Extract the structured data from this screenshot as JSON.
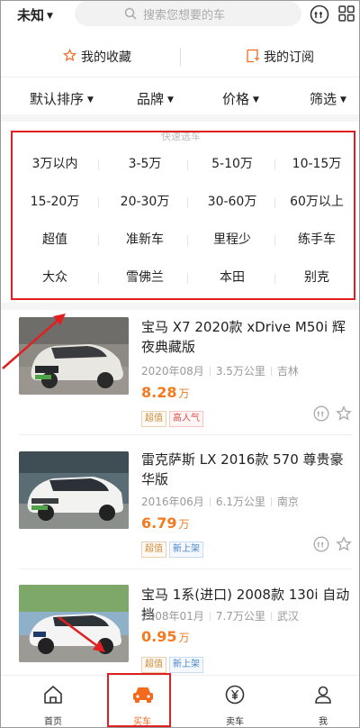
{
  "topbar": {
    "city": "未知",
    "search_placeholder": "搜索您想要的车"
  },
  "favorites": {
    "collect_label": "我的收藏",
    "subscribe_label": "我的订阅"
  },
  "filters": [
    "默认排序",
    "品牌",
    "价格",
    "筛选"
  ],
  "quick_select": {
    "title": "快速选车",
    "rows": [
      [
        "3万以内",
        "3-5万",
        "5-10万",
        "10-15万"
      ],
      [
        "15-20万",
        "20-30万",
        "30-60万",
        "60万以上"
      ],
      [
        "超值",
        "准新车",
        "里程少",
        "练手车"
      ],
      [
        "大众",
        "雪佛兰",
        "本田",
        "别克"
      ]
    ]
  },
  "listings": [
    {
      "title": "宝马 X7 2020款 xDrive M50i 辉夜典藏版",
      "date": "2020年08月",
      "mileage": "3.5万公里",
      "city": "吉林",
      "price": "8.28",
      "unit": "万",
      "tags": [
        "超值",
        "高人气"
      ]
    },
    {
      "title": "雷克萨斯 LX 2016款 570 尊贵豪华版",
      "date": "2016年06月",
      "mileage": "6.1万公里",
      "city": "南京",
      "price": "6.79",
      "unit": "万",
      "tags": [
        "超值",
        "新上架"
      ]
    },
    {
      "title": "宝马 1系(进口) 2008款 130i 自动挡",
      "date": "2008年01月",
      "mileage": "7.7万公里",
      "city": "武汉",
      "price": "0.95",
      "unit": "万",
      "tags": [
        "超值",
        "新上架"
      ]
    }
  ],
  "bottom_nav": [
    {
      "label": "首页",
      "active": false
    },
    {
      "label": "买车",
      "active": true
    },
    {
      "label": "卖车",
      "active": false
    },
    {
      "label": "我",
      "active": false
    }
  ],
  "colors": {
    "accent": "#f36a1e",
    "price": "#f47a1f",
    "annotation": "#e02020"
  }
}
